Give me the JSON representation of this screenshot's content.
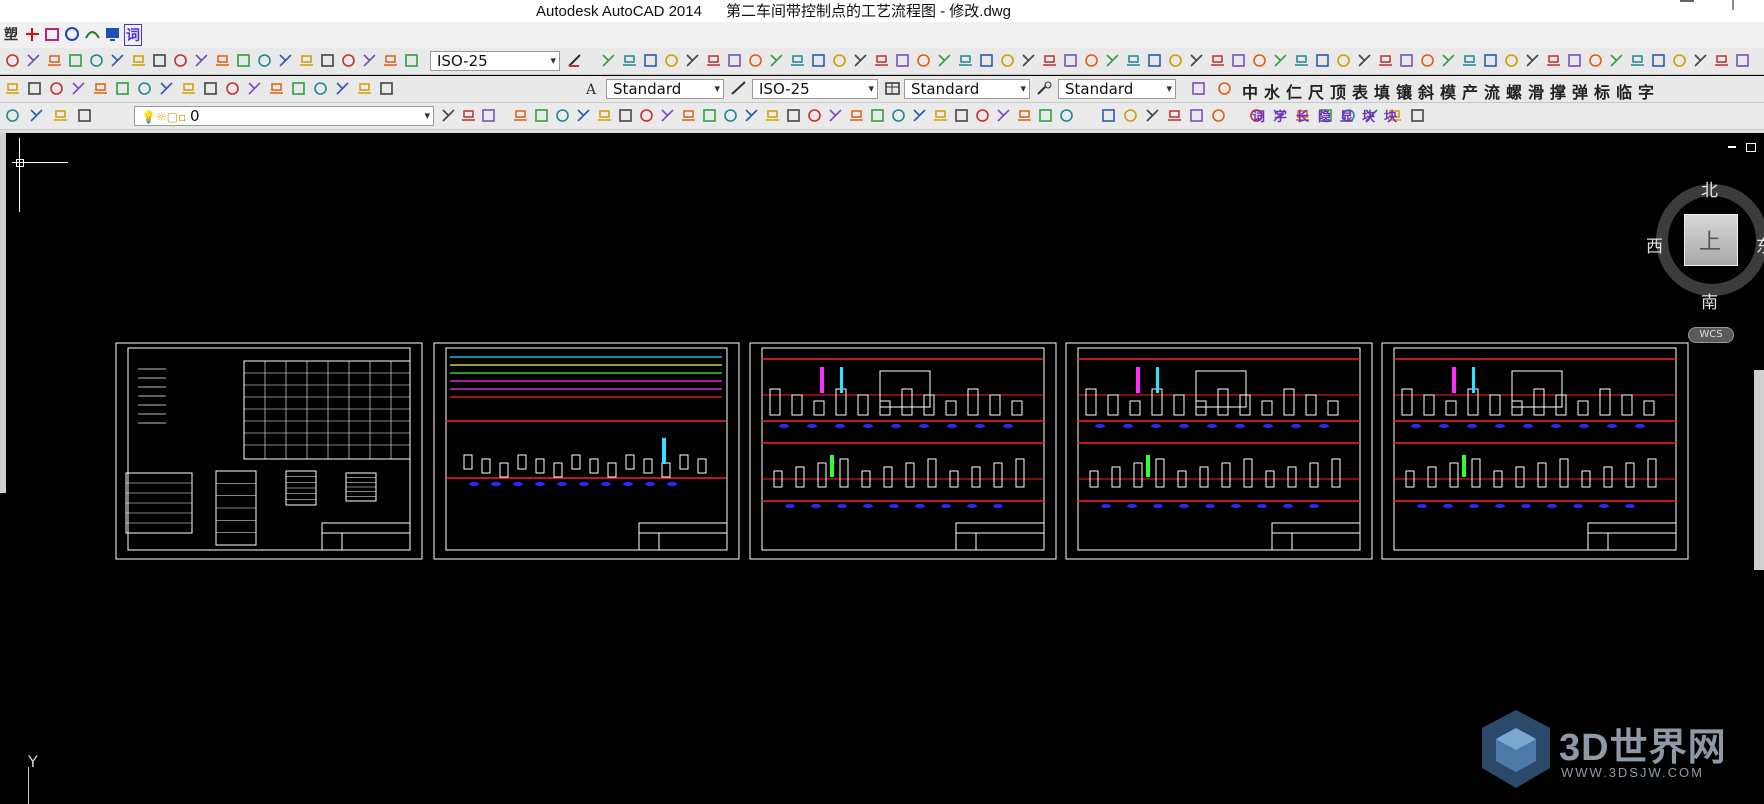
{
  "window": {
    "title": "Autodesk AutoCAD 2014",
    "document": "第二车间带控制点的工艺流程图 - 修改.dwg"
  },
  "toolbar1": {
    "dimstyle": "ISO-25",
    "cn_chars": [
      "塑",
      "词"
    ]
  },
  "toolbar2": {
    "textstyle": "Standard",
    "dimstyle": "ISO-25",
    "tablestyle": "Standard",
    "mleaderstyle": "Standard",
    "cn_chars": [
      "中",
      "水",
      "仁",
      "尺",
      "顶",
      "表",
      "填",
      "镶",
      "斜",
      "模",
      "产",
      "流",
      "螺",
      "滑",
      "撑",
      "弹",
      "标",
      "临",
      "字"
    ]
  },
  "toolbar3": {
    "layer": "0",
    "cn_chars": [
      "词",
      "字",
      "长",
      "隐",
      "显",
      "块",
      "块"
    ]
  },
  "viewcube": {
    "north": "北",
    "south": "南",
    "west": "西",
    "east": "东",
    "top": "上",
    "wcs": "WCS"
  },
  "ucs": {
    "y": "Y"
  },
  "watermark": {
    "brand": "3D世界网",
    "url": "WWW.3DSJW.COM"
  },
  "colors": {
    "red": "#ff2020",
    "blue": "#2a2aff",
    "white": "#ffffff",
    "magenta": "#ff30ff",
    "green": "#30ff30",
    "cyan": "#30e0ff",
    "yellow": "#ffff30"
  }
}
